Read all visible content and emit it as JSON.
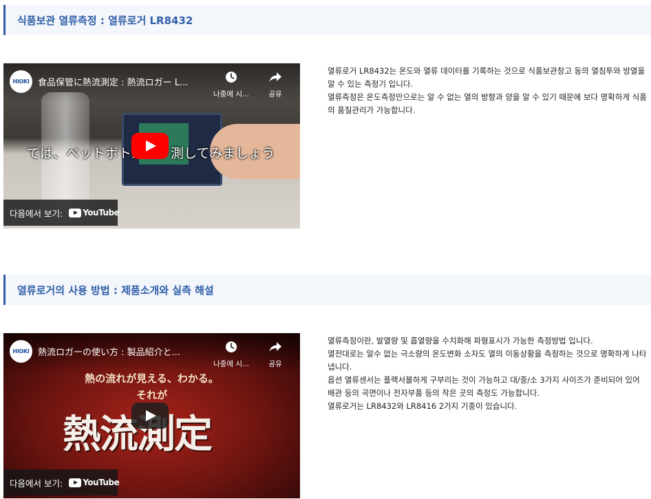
{
  "section1": {
    "header": "식품보관 열류측정 : 열류로거 LR8432",
    "video": {
      "logo": "HIOKI",
      "title": "食品保管に熱流測定 : 熱流ロガー L...",
      "watch_later": "나중에 시...",
      "share": "공유",
      "subtitle": "では、ペットボトル　　測してみましょう",
      "watch_on": "다음에서 보기:",
      "youtube": "YouTube"
    },
    "description": [
      "열류로거 LR8432는 온도와 열류 데이터를 기록하는 것으로 식품보관창고 등의 열침투와 방열을 알 수 있는 측정기 입니다.",
      "열류측정은 온도측정만으로는 알 수 없는 열의 방향과 양을 알 수 있기 때문에 보다 명확하게 식품의 품질관리가 가능합니다."
    ]
  },
  "section2": {
    "header": "열류로거의 사용 방법 : 제품소개와 실측 해설",
    "video": {
      "logo": "HIOKI",
      "title": "熱流ロガーの使い方 : 製品紹介と...",
      "watch_later": "나중에 시...",
      "share": "공유",
      "line1": "熱の流れが見える、わかる。",
      "line2": "それが",
      "bigtext": "熱流測定",
      "watch_on": "다음에서 보기:",
      "youtube": "YouTube"
    },
    "description": [
      "열류측정이란, 발열량 및 흡열량을 수치화해 파형표시가 가능한 측정방법 입니다.",
      "열전대로는 알수 없는 극소량의 온도변화 소자도 열의 이동상황을 측정하는 것으로 명확하게 나타냅니다.",
      "옵션 열류센서는 플랙서블하게 구부리는 것이 가능하고 대/중/소 3가지 사이즈가 준비되어 있어 배관 등의 곡면이나 전자부품 등의 작은 곳의 측정도 가능합니다.",
      "열류로거는 LR8432와 LR8416 2가지 기종이 있습니다."
    ]
  },
  "colors": {
    "accent": "#2f5ea8",
    "header_bg": "#f3f6fb",
    "play_red": "#ff0000"
  }
}
